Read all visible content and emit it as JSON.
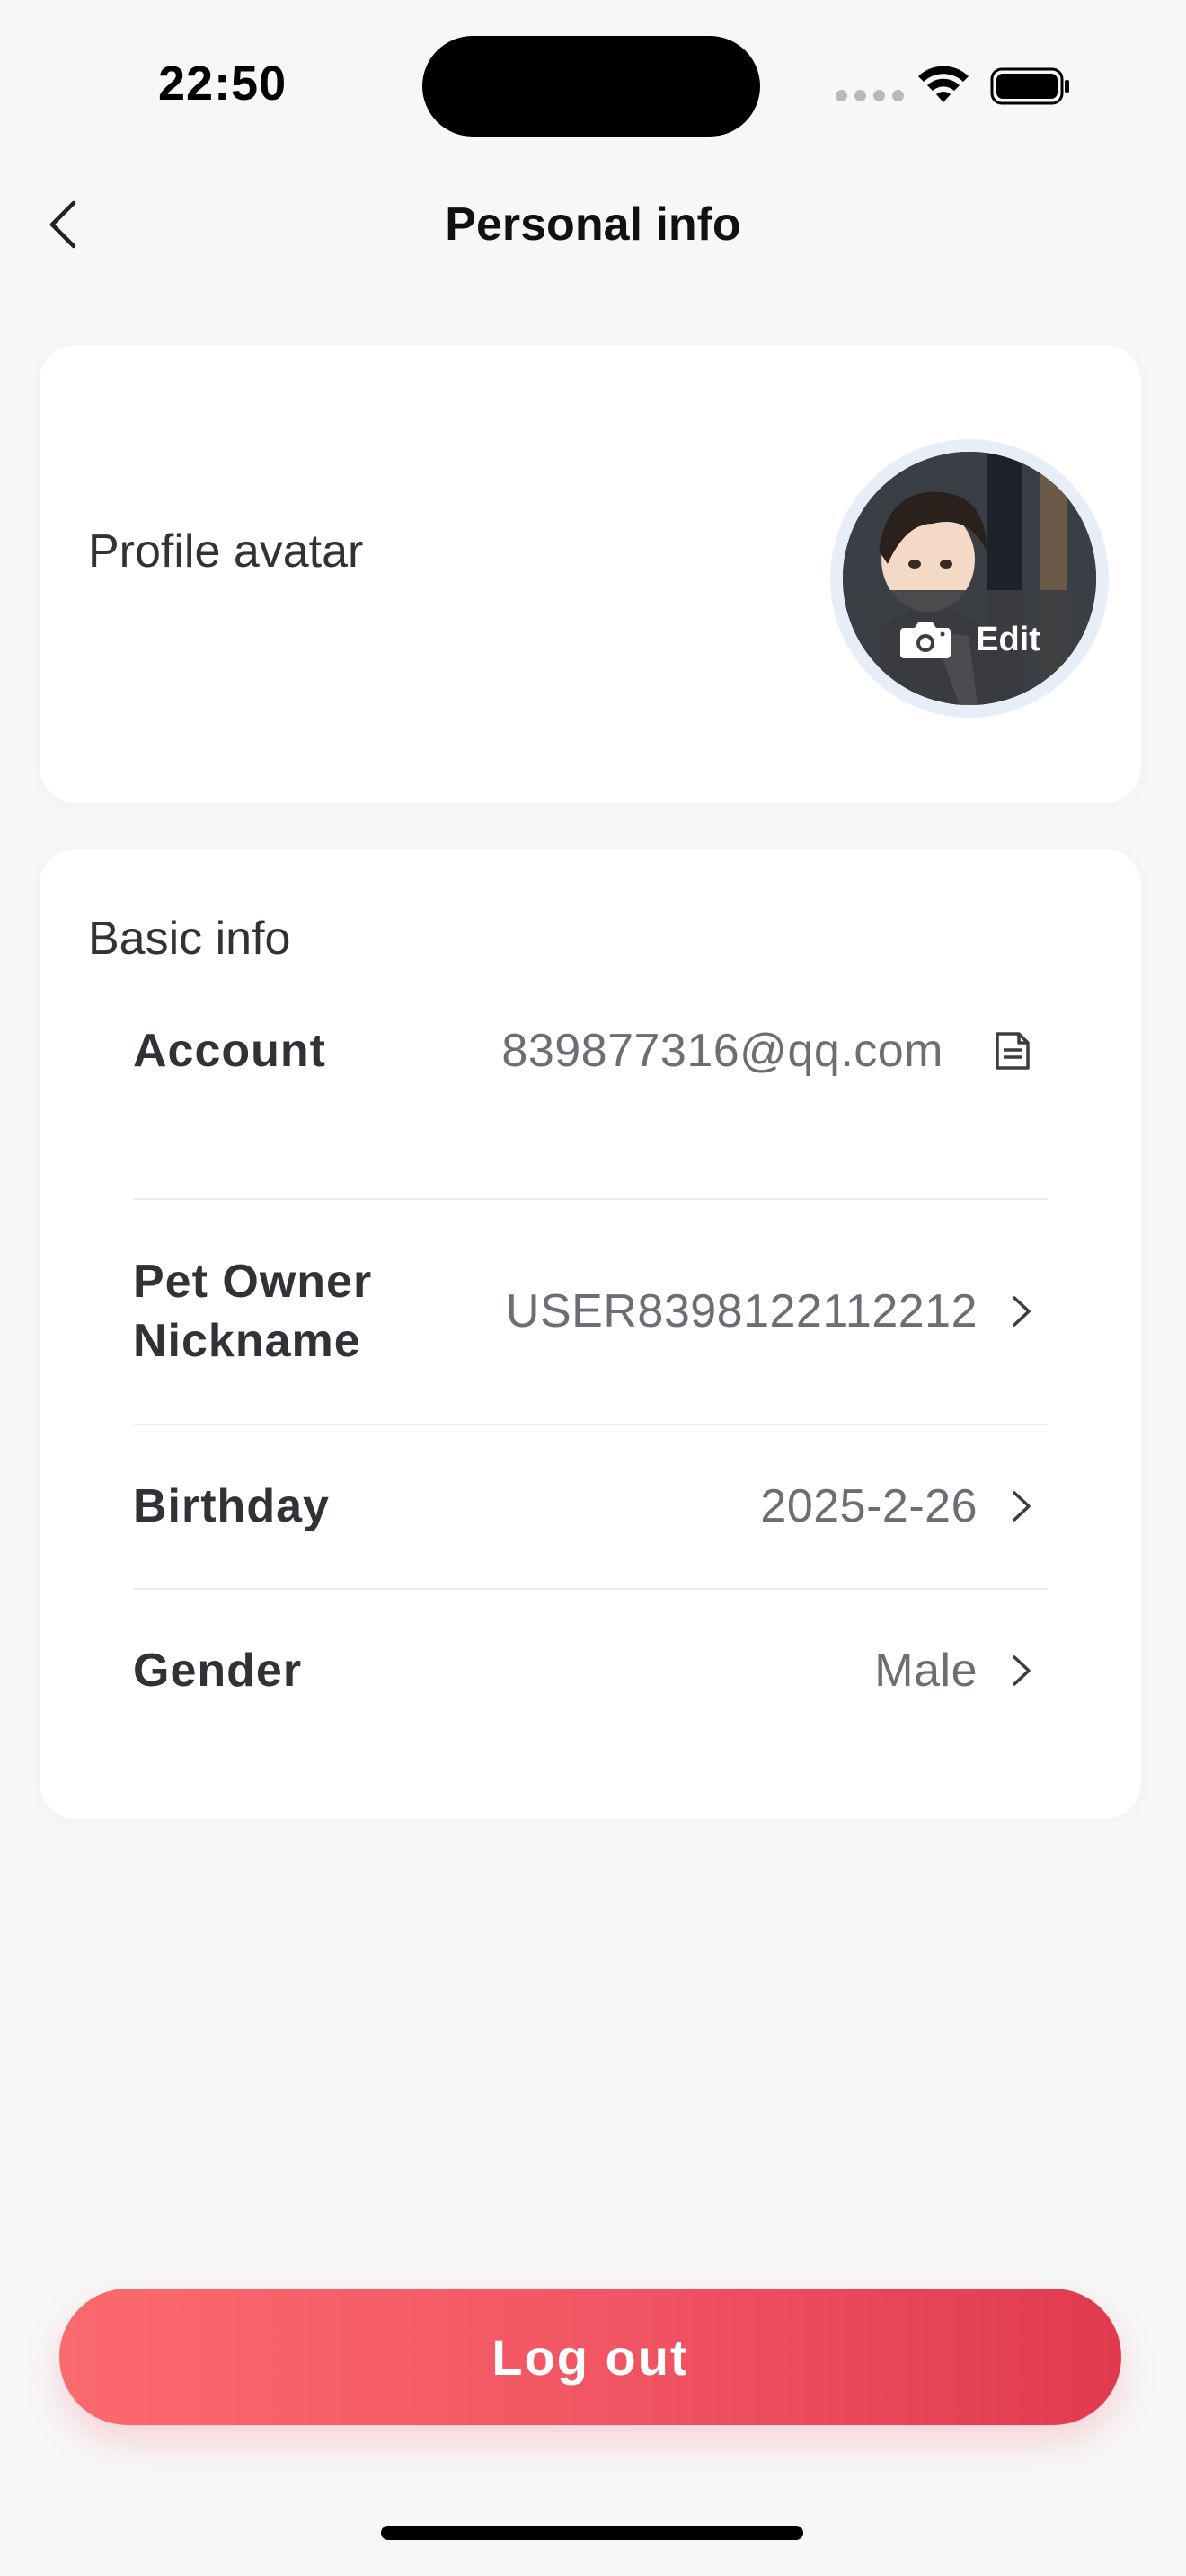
{
  "status_bar": {
    "time": "22:50"
  },
  "nav": {
    "title": "Personal info",
    "back_icon": "chevron-left-icon"
  },
  "avatar_section": {
    "label": "Profile avatar",
    "edit_label": "Edit",
    "camera_icon": "camera-icon"
  },
  "basic_info": {
    "title": "Basic info",
    "rows": [
      {
        "label": "Account",
        "value": "839877316@qq.com",
        "icon": "copy-document-icon"
      },
      {
        "label_line1": "Pet Owner",
        "label_line2": "Nickname",
        "value": "USER8398122112212",
        "icon": "chevron-right-icon"
      },
      {
        "label": "Birthday",
        "value": "2025-2-26",
        "icon": "chevron-right-icon"
      },
      {
        "label": "Gender",
        "value": "Male",
        "icon": "chevron-right-icon"
      }
    ]
  },
  "logout": {
    "label": "Log out"
  },
  "colors": {
    "background": "#f7f7f8",
    "card": "#ffffff",
    "logout_gradient_start": "#fb6a6d",
    "logout_gradient_end": "#e03a4e",
    "label_text": "#2f3236",
    "value_text": "#6b6f75"
  }
}
